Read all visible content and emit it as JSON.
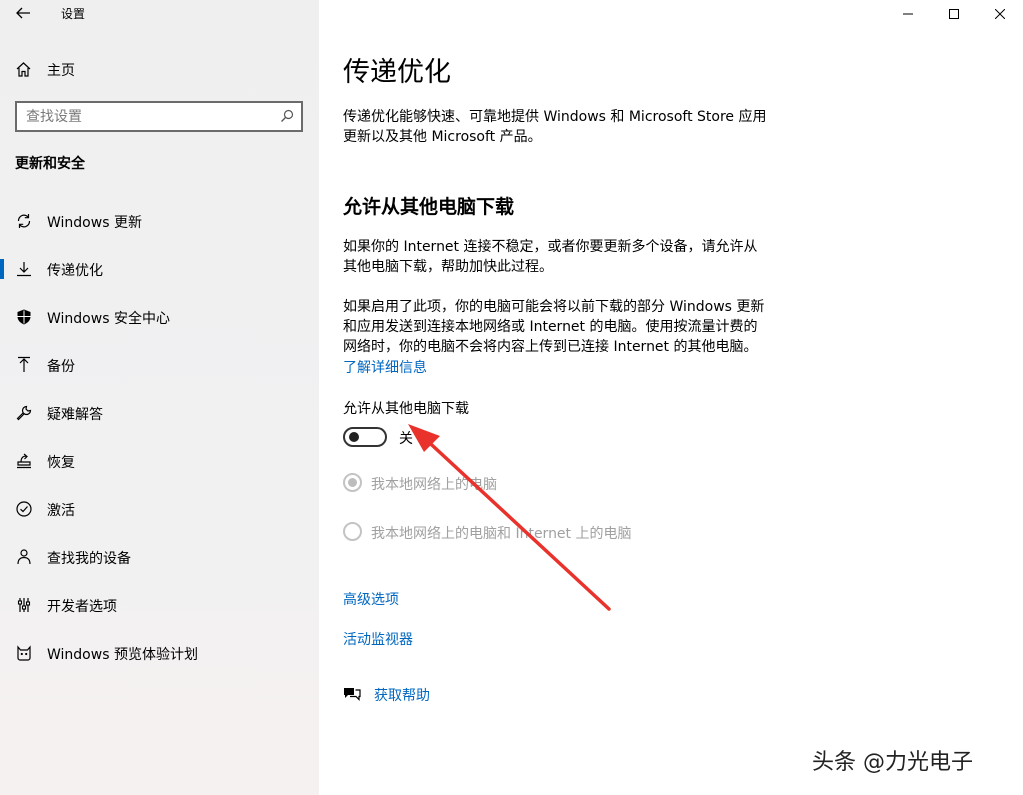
{
  "window": {
    "title": "设置"
  },
  "sidebar": {
    "home_label": "主页",
    "search_placeholder": "查找设置",
    "section_title": "更新和安全",
    "items": [
      {
        "label": "Windows 更新",
        "icon": "refresh-icon"
      },
      {
        "label": "传递优化",
        "icon": "delivery-icon",
        "active": true
      },
      {
        "label": "Windows 安全中心",
        "icon": "shield-icon"
      },
      {
        "label": "备份",
        "icon": "backup-icon"
      },
      {
        "label": "疑难解答",
        "icon": "wrench-icon"
      },
      {
        "label": "恢复",
        "icon": "recovery-icon"
      },
      {
        "label": "激活",
        "icon": "activation-icon"
      },
      {
        "label": "查找我的设备",
        "icon": "find-device-icon"
      },
      {
        "label": "开发者选项",
        "icon": "developer-icon"
      },
      {
        "label": "Windows 预览体验计划",
        "icon": "insider-icon"
      }
    ]
  },
  "main": {
    "title": "传递优化",
    "intro_line1": "传递优化能够快速、可靠地提供 Windows 和 Microsoft Store 应用",
    "intro_line2": "更新以及其他 Microsoft 产品。",
    "section_title": "允许从其他电脑下载",
    "para1_line1": "如果你的 Internet 连接不稳定，或者你要更新多个设备，请允许从",
    "para1_line2": "其他电脑下载，帮助加快此过程。",
    "para2_line1": "如果启用了此项，你的电脑可能会将以前下载的部分 Windows 更新",
    "para2_line2": "和应用发送到连接本地网络或 Internet 的电脑。使用按流量计费的",
    "para2_line3": "网络时，你的电脑不会将内容上传到已连接 Internet 的其他电脑。",
    "learn_more": "了解详细信息",
    "toggle_label": "允许从其他电脑下载",
    "toggle_state": "关",
    "radio_local": "我本地网络上的电脑",
    "radio_internet": "我本地网络上的电脑和 Internet 上的电脑",
    "advanced_options": "高级选项",
    "activity_monitor": "活动监视器",
    "get_help": "获取帮助"
  },
  "watermark": "头条 @力光电子",
  "colors": {
    "accent": "#0067c0",
    "arrow": "#e8322b"
  }
}
